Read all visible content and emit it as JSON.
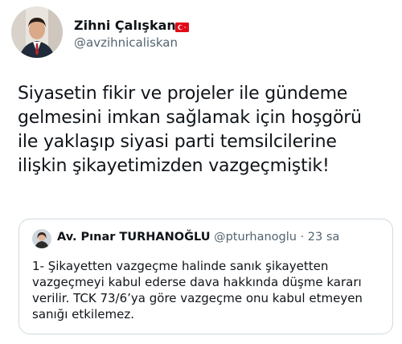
{
  "tweet": {
    "author": {
      "name": "Zihni Çalışkan",
      "handle": "@avzihnicaliskan",
      "flag_icon": "turkey-flag-icon"
    },
    "text": "Siyasetin fikir ve projeler ile gündeme\ngelmesini imkan sağlamak için hoşgörü\nile yaklaşıp siyasi parti temsilcilerine\nilişkin şikayetimizden vazgeçmiştik!",
    "quote": {
      "author_name": "Av. Pınar TURHANOĞLU",
      "handle": "@pturhanoglu",
      "separator": "·",
      "time": "23 sa",
      "text": "1- Şikayetten vazgeçme halinde sanık şikayetten\nvazgeçmeyi kabul ederse dava hakkında düşme kararı\nverilir. TCK 73/6’ya göre vazgeçme onu kabul etmeyen\nsanığı etkilemez."
    }
  },
  "colors": {
    "text": "#0f1419",
    "secondary": "#536471",
    "border": "#cfd9de",
    "flag_red": "#e30a17"
  }
}
